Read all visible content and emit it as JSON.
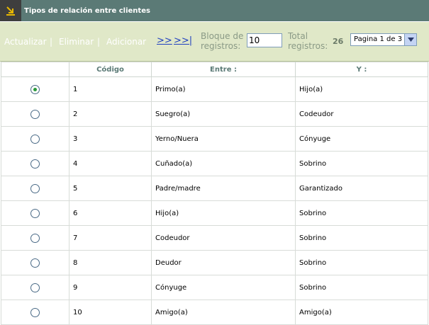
{
  "window": {
    "title": "Tipos de relación entre clientes"
  },
  "toolbar": {
    "refresh": "Actualizar",
    "delete": "Eliminar",
    "add": "Adicionar",
    "sep": "|",
    "next": ">>",
    "last": ">>|",
    "block_label_1": "Bloque de",
    "block_label_2": "registros:",
    "block_value": "10",
    "total_label_1": "Total",
    "total_label_2": "registros:",
    "total_value": "26",
    "page_value": "Pagina 1 de 3"
  },
  "table": {
    "headers": [
      "",
      "Código",
      "Entre :",
      "Y :"
    ],
    "rows": [
      {
        "code": "1",
        "between": "Primo(a)",
        "and": "Hijo(a)",
        "selected": true
      },
      {
        "code": "2",
        "between": "Suegro(a)",
        "and": "Codeudor",
        "selected": false
      },
      {
        "code": "3",
        "between": "Yerno/Nuera",
        "and": "Cónyuge",
        "selected": false
      },
      {
        "code": "4",
        "between": "Cuñado(a)",
        "and": "Sobrino",
        "selected": false
      },
      {
        "code": "5",
        "between": "Padre/madre",
        "and": "Garantizado",
        "selected": false
      },
      {
        "code": "6",
        "between": "Hijo(a)",
        "and": "Sobrino",
        "selected": false
      },
      {
        "code": "7",
        "between": "Codeudor",
        "and": "Sobrino",
        "selected": false
      },
      {
        "code": "8",
        "between": "Deudor",
        "and": "Sobrino",
        "selected": false
      },
      {
        "code": "9",
        "between": "Cónyuge",
        "and": "Sobrino",
        "selected": false
      },
      {
        "code": "10",
        "between": "Amigo(a)",
        "and": "Amigo(a)",
        "selected": false
      }
    ]
  }
}
